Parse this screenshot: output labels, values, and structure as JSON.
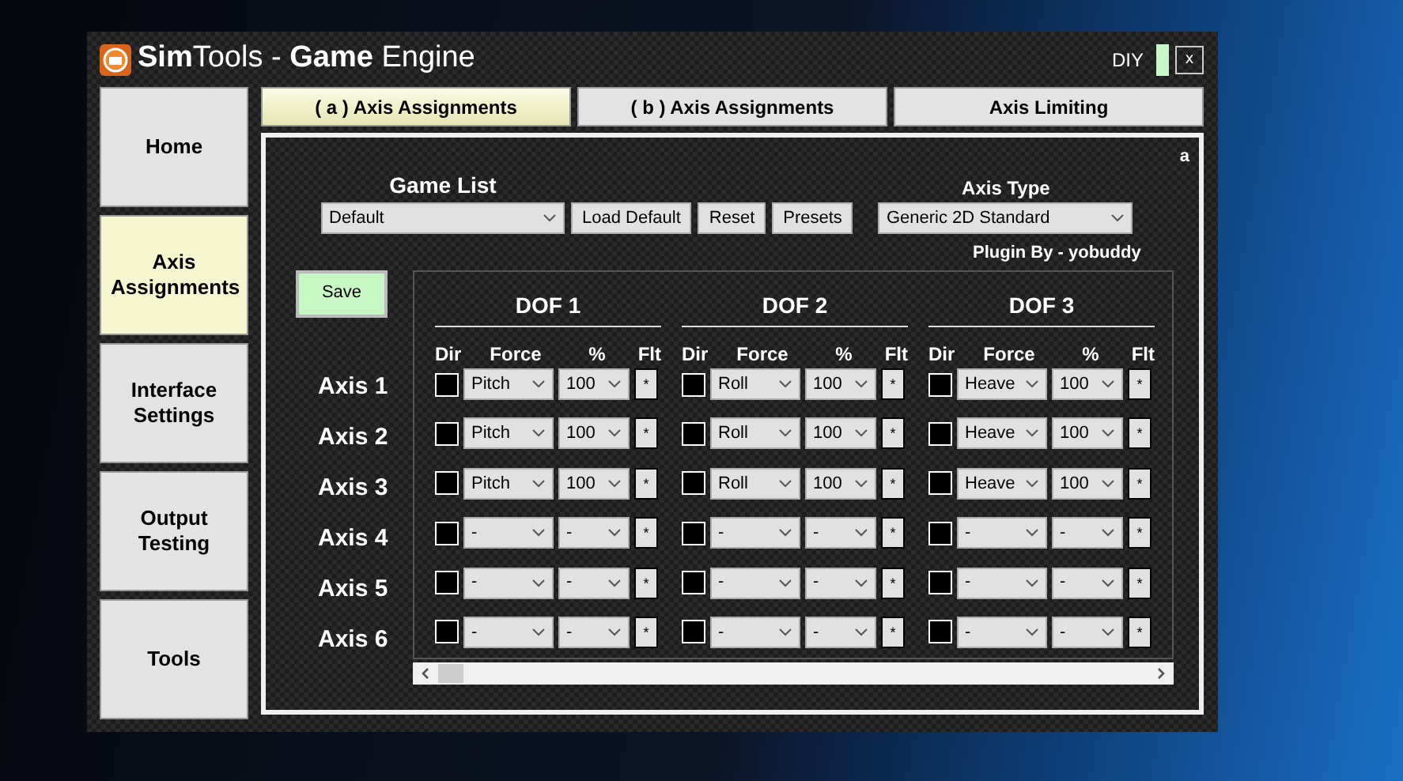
{
  "window": {
    "title": "**Sim**Tools - **Game** Engine",
    "mode": "DIY",
    "close": "x"
  },
  "sidebar": {
    "items": [
      {
        "label": "Home",
        "selected": false
      },
      {
        "label": "Axis Assignments",
        "selected": true
      },
      {
        "label": "Interface Settings",
        "selected": false
      },
      {
        "label": "Output Testing",
        "selected": false
      },
      {
        "label": "Tools",
        "selected": false
      }
    ]
  },
  "tabs": [
    {
      "label": "( a ) Axis Assignments",
      "selected": true
    },
    {
      "label": "( b ) Axis Assignments",
      "selected": false
    },
    {
      "label": "Axis Limiting",
      "selected": false
    }
  ],
  "panel": {
    "corner_label": "a",
    "game_list": {
      "label": "Game List",
      "value": "Default"
    },
    "buttons": [
      "Load Default",
      "Reset",
      "Presets"
    ],
    "axis_type": {
      "label": "Axis Type",
      "value": "Generic 2D Standard"
    },
    "plugin_by": "Plugin By - yobuddy",
    "save": "Save",
    "dofs": [
      {
        "title": "DOF 1",
        "columns": [
          "Dir",
          "Force",
          "%",
          "Flt"
        ]
      },
      {
        "title": "DOF 2",
        "columns": [
          "Dir",
          "Force",
          "%",
          "Flt"
        ]
      },
      {
        "title": "DOF 3",
        "columns": [
          "Dir",
          "Force",
          "%",
          "Flt"
        ]
      }
    ],
    "axes": [
      {
        "label": "Axis 1",
        "cells": [
          {
            "checked": false,
            "force": "Pitch",
            "percent": "100",
            "flt": "*"
          },
          {
            "checked": false,
            "force": "Roll",
            "percent": "100",
            "flt": "*"
          },
          {
            "checked": false,
            "force": "Heave",
            "percent": "100",
            "flt": "*"
          }
        ]
      },
      {
        "label": "Axis 2",
        "cells": [
          {
            "checked": false,
            "force": "Pitch",
            "percent": "100",
            "flt": "*"
          },
          {
            "checked": false,
            "force": "Roll",
            "percent": "100",
            "flt": "*"
          },
          {
            "checked": false,
            "force": "Heave",
            "percent": "100",
            "flt": "*"
          }
        ]
      },
      {
        "label": "Axis 3",
        "cells": [
          {
            "checked": false,
            "force": "Pitch",
            "percent": "100",
            "flt": "*"
          },
          {
            "checked": false,
            "force": "Roll",
            "percent": "100",
            "flt": "*"
          },
          {
            "checked": false,
            "force": "Heave",
            "percent": "100",
            "flt": "*"
          }
        ]
      },
      {
        "label": "Axis 4",
        "cells": [
          {
            "checked": false,
            "force": "-",
            "percent": "-",
            "flt": "*"
          },
          {
            "checked": false,
            "force": "-",
            "percent": "-",
            "flt": "*"
          },
          {
            "checked": false,
            "force": "-",
            "percent": "-",
            "flt": "*"
          }
        ]
      },
      {
        "label": "Axis 5",
        "cells": [
          {
            "checked": false,
            "force": "-",
            "percent": "-",
            "flt": "*"
          },
          {
            "checked": false,
            "force": "-",
            "percent": "-",
            "flt": "*"
          },
          {
            "checked": false,
            "force": "-",
            "percent": "-",
            "flt": "*"
          }
        ]
      },
      {
        "label": "Axis 6",
        "cells": [
          {
            "checked": false,
            "force": "-",
            "percent": "-",
            "flt": "*"
          },
          {
            "checked": false,
            "force": "-",
            "percent": "-",
            "flt": "*"
          },
          {
            "checked": false,
            "force": "-",
            "percent": "-",
            "flt": "*"
          }
        ]
      }
    ]
  }
}
